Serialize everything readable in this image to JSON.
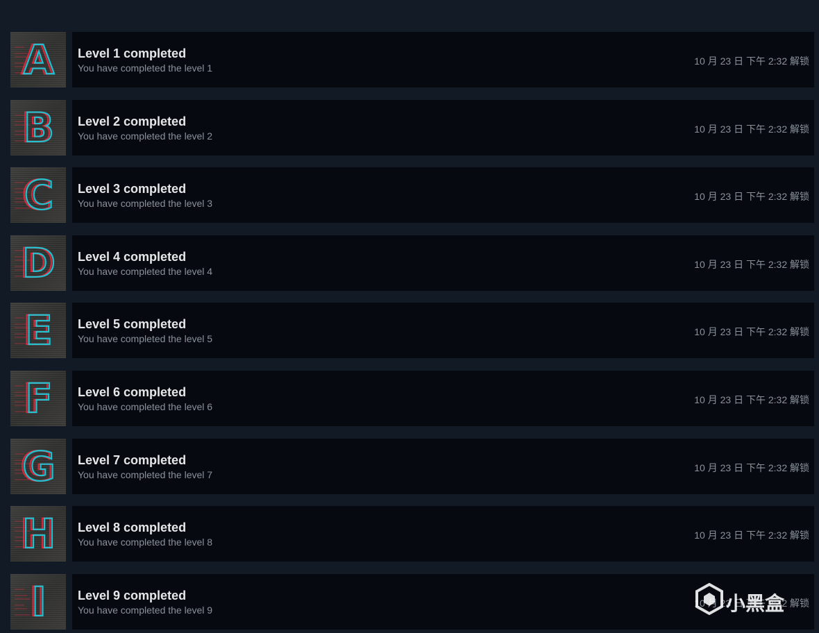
{
  "achievements": [
    {
      "letter": "A",
      "title": "Level 1 completed",
      "description": "You have completed the level 1",
      "unlocked": "10 月 23 日 下午 2:32 解锁"
    },
    {
      "letter": "B",
      "title": "Level 2 completed",
      "description": "You have completed the level 2",
      "unlocked": "10 月 23 日 下午 2:32 解锁"
    },
    {
      "letter": "C",
      "title": "Level 3 completed",
      "description": "You have completed the level 3",
      "unlocked": "10 月 23 日 下午 2:32 解锁"
    },
    {
      "letter": "D",
      "title": "Level 4 completed",
      "description": "You have completed the level 4",
      "unlocked": "10 月 23 日 下午 2:32 解锁"
    },
    {
      "letter": "E",
      "title": "Level 5 completed",
      "description": "You have completed the level 5",
      "unlocked": "10 月 23 日 下午 2:32 解锁"
    },
    {
      "letter": "F",
      "title": "Level 6 completed",
      "description": "You have completed the level 6",
      "unlocked": "10 月 23 日 下午 2:32 解锁"
    },
    {
      "letter": "G",
      "title": "Level 7 completed",
      "description": "You have completed the level 7",
      "unlocked": "10 月 23 日 下午 2:32 解锁"
    },
    {
      "letter": "H",
      "title": "Level 8 completed",
      "description": "You have completed the level 8",
      "unlocked": "10 月 23 日 下午 2:32 解锁"
    },
    {
      "letter": "I",
      "title": "Level 9 completed",
      "description": "You have completed the level 9",
      "unlocked": "10 月 23 日 下午 2:32 解锁"
    }
  ],
  "watermark": {
    "text": "小黑盒",
    "icon": "xiaoheihe-logo-icon"
  },
  "colors": {
    "background": "#121a25",
    "card": "#060a10",
    "title": "#e6e7e9",
    "secondary_text": "#8b929a",
    "glitch_cyan": "#1ec8d8",
    "glitch_red": "#e0283a"
  }
}
